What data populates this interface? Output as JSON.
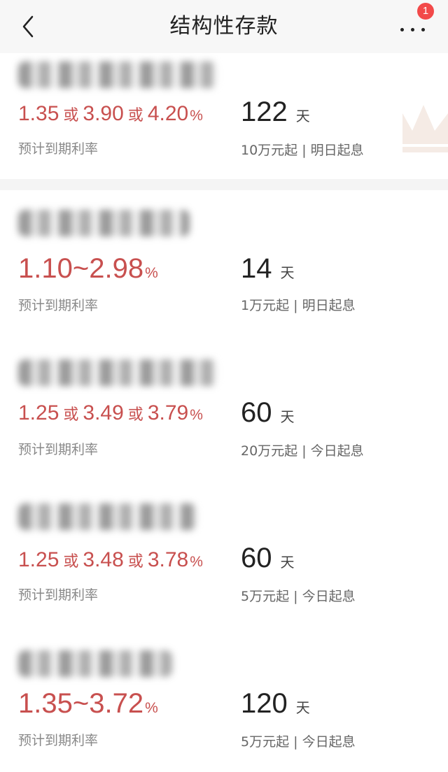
{
  "header": {
    "title": "结构性存款",
    "badge_count": "1"
  },
  "products": [
    {
      "rate_parts": [
        "1.35",
        "或",
        "3.90",
        "或",
        "4.20",
        "%"
      ],
      "rate_label": "预计到期利率",
      "days": "122",
      "days_unit": "天",
      "condition": "10万元起 | 明日起息"
    },
    {
      "rate_range": "1.10~2.98",
      "rate_pct": "%",
      "rate_label": "预计到期利率",
      "days": "14",
      "days_unit": "天",
      "condition": "1万元起 | 明日起息"
    },
    {
      "rate_parts": [
        "1.25",
        "或",
        "3.49",
        "或",
        "3.79",
        "%"
      ],
      "rate_label": "预计到期利率",
      "days": "60",
      "days_unit": "天",
      "condition": "20万元起 | 今日起息"
    },
    {
      "rate_parts": [
        "1.25",
        "或",
        "3.48",
        "或",
        "3.78",
        "%"
      ],
      "rate_label": "预计到期利率",
      "days": "60",
      "days_unit": "天",
      "condition": "5万元起 | 今日起息"
    },
    {
      "rate_range": "1.35~3.72",
      "rate_pct": "%",
      "rate_label": "预计到期利率",
      "days": "120",
      "days_unit": "天",
      "condition": "5万元起 | 今日起息"
    }
  ],
  "colors": {
    "rate": "#c8504f",
    "badge": "#f24949",
    "crown": "#f3e6df"
  },
  "icons": [
    "back-arrow-icon",
    "more-dots-icon",
    "crown-icon"
  ]
}
